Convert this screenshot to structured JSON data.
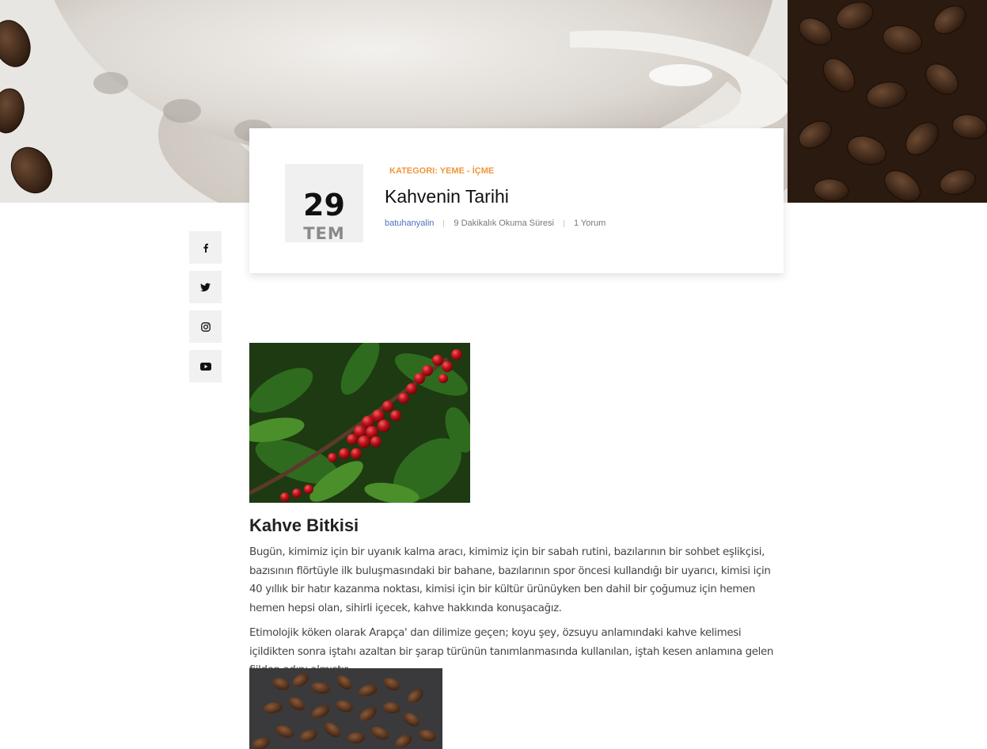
{
  "post": {
    "day": "29",
    "month": "TEM",
    "category": "KATEGORI: YEME - İÇME",
    "title": "Kahvenin Tarihi",
    "author": "batuhanyalin",
    "read_time": "9 Dakikalık Okuma Süresi",
    "comments": "1 Yorum"
  },
  "social": [
    {
      "name": "facebook",
      "icon": "facebook-icon"
    },
    {
      "name": "twitter",
      "icon": "twitter-icon"
    },
    {
      "name": "instagram",
      "icon": "instagram-icon"
    },
    {
      "name": "youtube",
      "icon": "youtube-icon"
    }
  ],
  "article": {
    "heading": "Kahve Bitkisi",
    "paragraph1": "Bugün, kimimiz için bir uyanık kalma aracı, kimimiz için bir sabah rutini, bazılarının bir sohbet eşlikçisi, bazısının flörtüyle ilk buluşmasındaki bir bahane, bazılarının spor öncesi kullandığı bir uyarıcı, kimisi için 40 yıllık bir hatır kazanma noktası, kimisi için bir kültür ürünüyken ben dahil bir çoğumuz için hemen hemen hepsi olan, sihirli içecek, kahve hakkında konuşacağız.",
    "paragraph2": "Etimolojik köken olarak Arapça' dan dilimize geçen; koyu şey, özsuyu anlamındaki kahve kelimesi içildikten sonra iştahı azaltan bir şarap türünün tanımlanmasında kullanılan, iştah kesen anlamına gelen fiilden adını almıştır."
  },
  "colors": {
    "category": "#f0963c",
    "author_link": "#4a72c4",
    "date_box_bg": "#f0f0f0",
    "social_bg": "#f1f1f1"
  }
}
